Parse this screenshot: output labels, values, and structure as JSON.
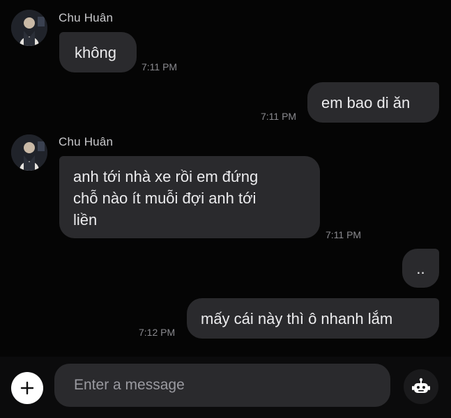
{
  "messages": [
    {
      "sender": "Chu Huân",
      "text": "không",
      "time": "7:11 PM"
    },
    {
      "text": "em bao di ăn",
      "time": "7:11 PM"
    },
    {
      "sender": "Chu Huân",
      "text_lines": [
        "anh tới nhà xe rồi em đứng",
        "chỗ nào ít muỗi đợi anh tới",
        "liền"
      ],
      "time": "7:11 PM"
    },
    {
      "text": ".."
    },
    {
      "text": "mấy cái này thì ô nhanh lắm",
      "time": "7:12 PM"
    }
  ],
  "composer": {
    "placeholder": "Enter a message",
    "add_icon": "plus-icon",
    "bot_icon": "robot-icon"
  },
  "colors": {
    "background": "#050505",
    "bubble": "#2a2a2d",
    "text": "#ececee",
    "timestamp": "#8a8a8f"
  }
}
